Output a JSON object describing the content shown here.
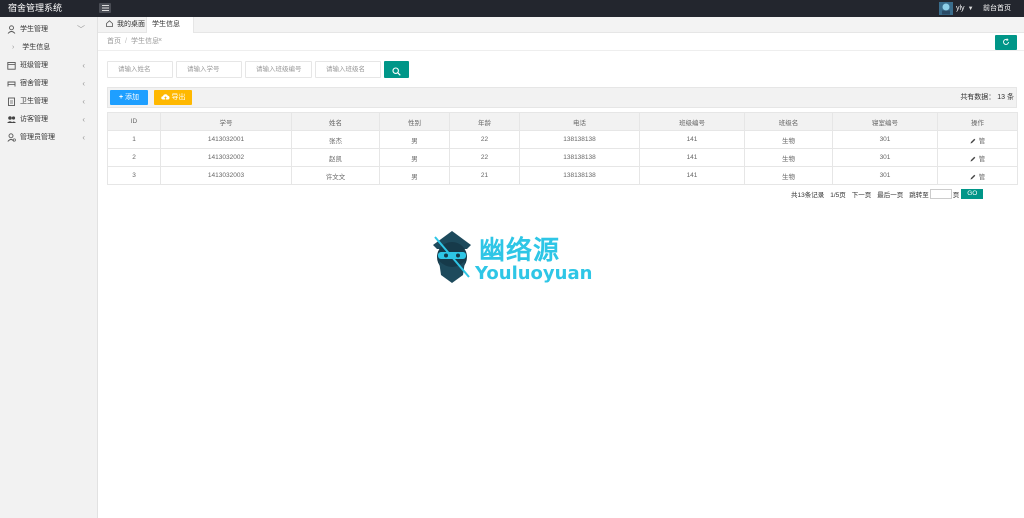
{
  "header": {
    "logo": "宿舍管理系统",
    "user_name": "yly",
    "front_link": "前台首页"
  },
  "sidebar": {
    "items": [
      {
        "label": "学生管理",
        "arrow": "﹀",
        "expanded": true
      },
      {
        "label": "班级管理",
        "arrow": "‹"
      },
      {
        "label": "宿舍管理",
        "arrow": "‹"
      },
      {
        "label": "卫生管理",
        "arrow": "‹"
      },
      {
        "label": "访客管理",
        "arrow": "‹"
      },
      {
        "label": "管理员管理",
        "arrow": "‹"
      }
    ],
    "sub_item": "学生信息"
  },
  "tabs": {
    "home_label": "我的桌面",
    "active_label": "学生信息",
    "close": "×"
  },
  "breadcrumb": {
    "home": "首页",
    "sep": "/",
    "current": "学生信息"
  },
  "search": {
    "name_placeholder": "请输入姓名",
    "id_placeholder": "请输入学号",
    "class_no_placeholder": "请输入班级编号",
    "class_name_placeholder": "请输入班级名"
  },
  "toolbar": {
    "add_label": "添加",
    "export_label": "导出",
    "total": "共有数据：  13 条"
  },
  "table": {
    "columns": [
      "ID",
      "学号",
      "姓名",
      "性别",
      "年龄",
      "电话",
      "班级编号",
      "班级名",
      "寝室编号",
      "操作"
    ],
    "rows": [
      [
        "1",
        "1413032001",
        "张杰",
        "男",
        "22",
        "138138138",
        "141",
        "生物",
        "301"
      ],
      [
        "2",
        "1413032002",
        "赵凯",
        "男",
        "22",
        "138138138",
        "141",
        "生物",
        "301"
      ],
      [
        "3",
        "1413032003",
        "许文文",
        "男",
        "21",
        "138138138",
        "141",
        "生物",
        "301"
      ]
    ],
    "action_delete": "管"
  },
  "pagination": {
    "records": "共13条记录",
    "pages": "1/5页",
    "next": "下一页",
    "last": "最后一页",
    "jump_to": "跳转至",
    "page_unit": "页",
    "go": "GO"
  },
  "watermark": {
    "cn": "幽络源",
    "en": "Youluoyuan"
  },
  "colors": {
    "primary": "#009688",
    "blue": "#1e9fff",
    "orange": "#ffb800",
    "header_bg": "#23262e",
    "watermark": "#2ec6e6"
  }
}
